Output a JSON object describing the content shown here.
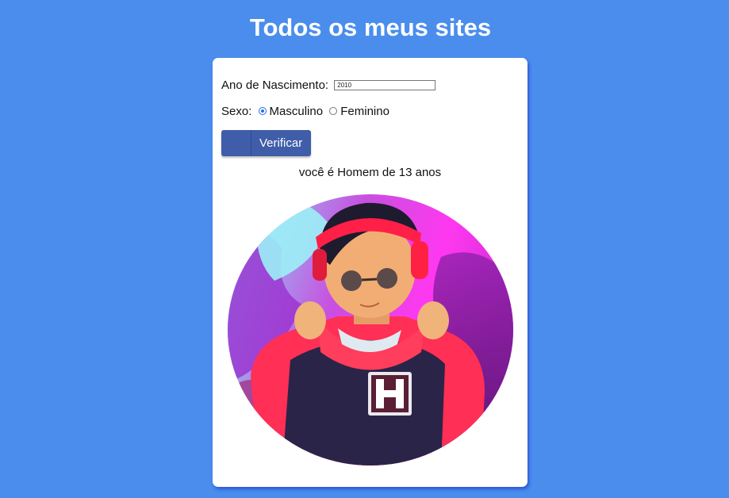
{
  "header": {
    "title": "Todos os meus sites"
  },
  "form": {
    "year_label": "Ano de Nascimento:",
    "year_value": "2010",
    "sex_label": "Sexo:",
    "options": [
      {
        "label": "Masculino",
        "checked": true
      },
      {
        "label": "Feminino",
        "checked": false
      }
    ],
    "button_label": "Verificar"
  },
  "result": {
    "text": "você é Homem de 13 anos"
  },
  "image": {
    "subject": "avatar-illustration"
  },
  "colors": {
    "page_background": "#4a8ded",
    "button_background": "#3f5da8",
    "radio_accent": "#1a73e8"
  }
}
